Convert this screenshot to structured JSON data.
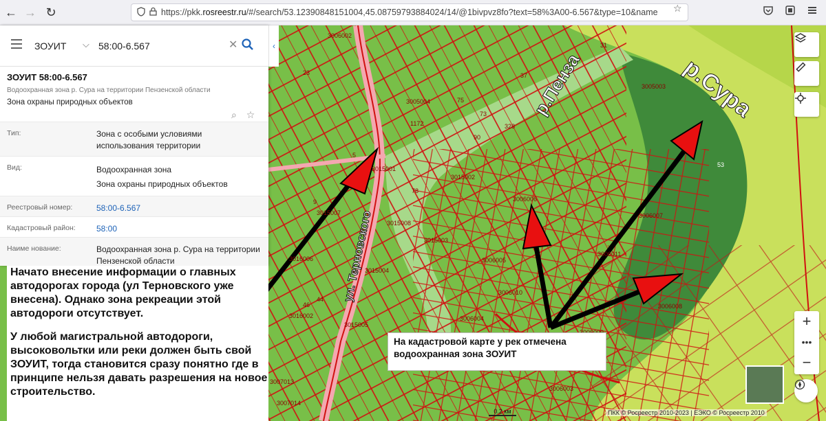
{
  "browser": {
    "url_prefix": "https://pkk.",
    "url_domain": "rosreestr.ru",
    "url_rest": "/#/search/53.12390848151004,45.08759793884024/14/@1bivpvz8fo?text=58%3A00-6.567&type=10&name"
  },
  "search": {
    "category": "ЗОУИТ",
    "query": "58:00-6.567"
  },
  "object": {
    "title": "ЗОУИТ 58:00-6.567",
    "subtitle": "Водоохранная зона р. Сура на территории Пензенской области",
    "kind": "Зона охраны природных объектов"
  },
  "attributes": [
    {
      "key": "Тип:",
      "value": "Зона с особыми условиями использования территории"
    },
    {
      "key": "Вид:",
      "value": "Водоохранная зона\nЗона охраны природных объектов"
    },
    {
      "key": "Реестровый номер:",
      "value": "58:00-6.567"
    },
    {
      "key": "Кадастровый район:",
      "value": "58:00"
    },
    {
      "key": "Наиме нование:",
      "value": "Водоохранная зона р. Сура на территории Пензенской области"
    }
  ],
  "annotations": {
    "left_p1": "Начато внесение информации о главных автодорогах города (ул Терновского уже внесена). Однако зона рекреации этой автодороги отсутствует.",
    "left_p2": "У любой магистральной автодороги, высоковольтки или реки должен быть свой ЗОУИТ, тогда становится сразу понятно где в принципе нельзя давать разрешения на новое строительство.",
    "callout": "На кадастровой карте у рек отмечена водоохранная зона ЗОУИТ"
  },
  "map": {
    "label_sura": "р.Сура",
    "label_penza": "р.Пенза",
    "label_street": "ул. Терновского",
    "parcels": [
      "3006002",
      "3005003",
      "3005004",
      "3015001",
      "3015002",
      "3006006",
      "3006007",
      "3015008",
      "3015003",
      "3006005",
      "3006011",
      "3006010",
      "3006008",
      "3006004",
      "3006009",
      "3015005",
      "3016002",
      "3016006",
      "3007013",
      "3007014",
      "3006003",
      "3015007",
      "3015004"
    ],
    "numbers": [
      "53",
      "37",
      "73",
      "1172",
      "328",
      "90",
      "78",
      "75",
      "5",
      "9",
      "31",
      "23",
      "46",
      "44"
    ],
    "scale": "0.2 км",
    "copyright": "ПКК © Росреестр 2010-2023 | ЕЭКО © Росреестр 2010"
  },
  "colors": {
    "zone_green": "#7dc24d",
    "river_zone": "#c8e05a",
    "parcel_red": "#d01010",
    "link_blue": "#1e63b8"
  }
}
